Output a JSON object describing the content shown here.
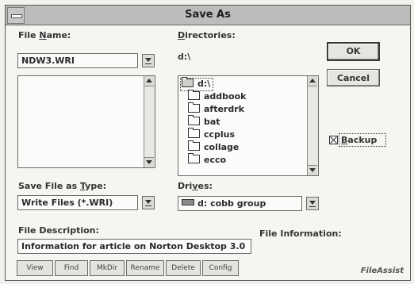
{
  "dialog": {
    "title": "Save As"
  },
  "file_name": {
    "label_pre": "File ",
    "label_underline": "N",
    "label_post": "ame:",
    "value": "NDW3.WRI"
  },
  "directories": {
    "label_underline": "D",
    "label_post": "irectories:",
    "current_path": "d:\\",
    "items": [
      {
        "name": "d:\\",
        "icon": "open-folder-icon"
      },
      {
        "name": "addbook",
        "icon": "folder-icon"
      },
      {
        "name": "afterdrk",
        "icon": "folder-icon"
      },
      {
        "name": "bat",
        "icon": "folder-icon"
      },
      {
        "name": "ccplus",
        "icon": "folder-icon"
      },
      {
        "name": "collage",
        "icon": "folder-icon"
      },
      {
        "name": "ecco",
        "icon": "folder-icon"
      }
    ]
  },
  "buttons": {
    "ok": "OK",
    "cancel": "Cancel"
  },
  "backup": {
    "label_underline": "B",
    "label_post": "ackup",
    "checked": true
  },
  "save_type": {
    "label_pre": "Save File as ",
    "label_underline": "T",
    "label_post": "ype:",
    "value": "Write Files (*.WRI)"
  },
  "drives": {
    "label_pre": "Dri",
    "label_underline": "v",
    "label_post": "es:",
    "value": "d: cobb group"
  },
  "file_description": {
    "label": "File Description:",
    "value": "Information for article on Norton Desktop 3.0"
  },
  "file_information": {
    "label": "File Information:"
  },
  "toolbar": {
    "view": "View",
    "find": "Find",
    "mkdir": "MkDir",
    "rename": "Rename",
    "delete": "Delete",
    "config": "Config"
  },
  "brand": "FileAssist"
}
